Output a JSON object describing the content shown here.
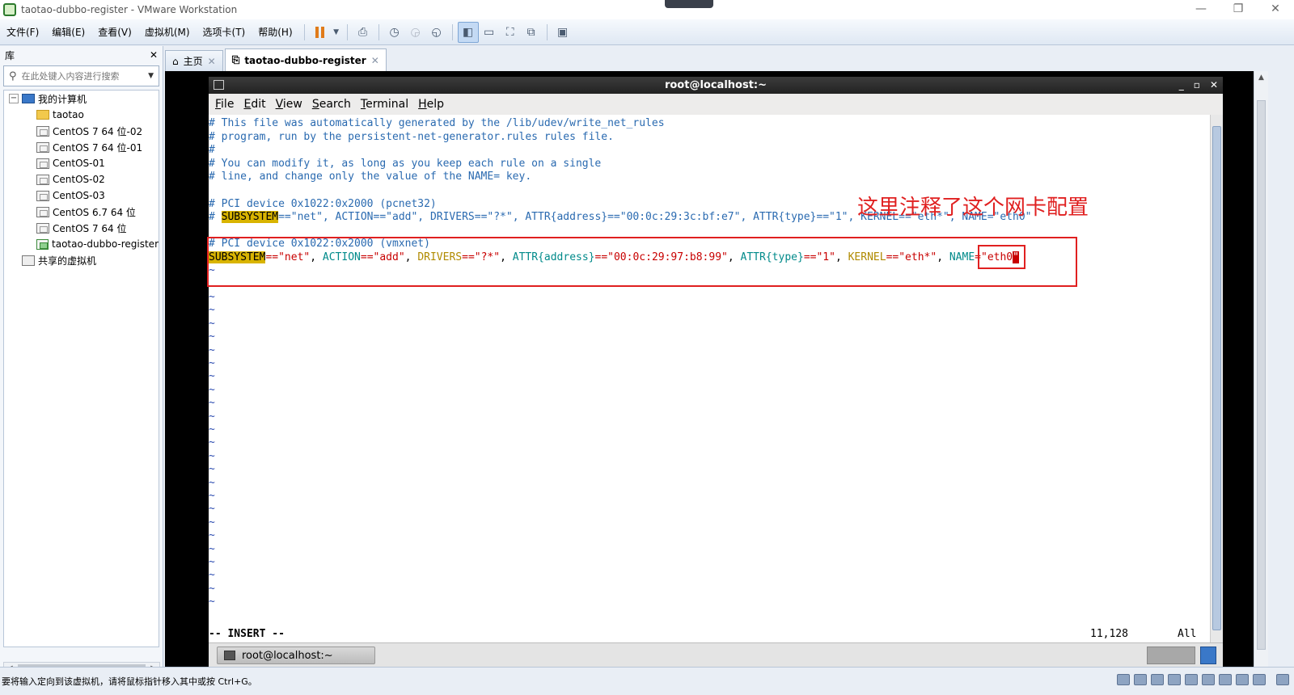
{
  "window": {
    "title": "taotao-dubbo-register - VMware Workstation",
    "minimize": "—",
    "restore": "❐",
    "close": "✕"
  },
  "menu": {
    "items": [
      "文件(F)",
      "编辑(E)",
      "查看(V)",
      "虚拟机(M)",
      "选项卡(T)",
      "帮助(H)"
    ]
  },
  "library": {
    "title": "库",
    "close": "✕",
    "search_placeholder": "在此处键入内容进行搜索",
    "items": [
      {
        "label": "我的计算机",
        "expander": "−"
      },
      {
        "label": "taotao"
      },
      {
        "label": "CentOS 7 64 位-02"
      },
      {
        "label": "CentOS 7 64 位-01"
      },
      {
        "label": "CentOS-01"
      },
      {
        "label": "CentOS-02"
      },
      {
        "label": "CentOS-03"
      },
      {
        "label": "CentOS 6.7 64 位"
      },
      {
        "label": "CentOS 7 64 位"
      },
      {
        "label": "taotao-dubbo-register"
      },
      {
        "label": "共享的虚拟机"
      }
    ]
  },
  "tabs": [
    {
      "label": "主页",
      "close": "✕"
    },
    {
      "label": "taotao-dubbo-register",
      "close": "✕"
    }
  ],
  "terminal": {
    "title": "root@localhost:~",
    "controls": [
      "_",
      "▫",
      "✕"
    ],
    "menu": [
      {
        "key": "F",
        "rest": "ile"
      },
      {
        "key": "E",
        "rest": "dit"
      },
      {
        "key": "V",
        "rest": "iew"
      },
      {
        "key": "S",
        "rest": "earch"
      },
      {
        "key": "T",
        "rest": "erminal"
      },
      {
        "key": "H",
        "rest": "elp"
      }
    ],
    "lines": {
      "l1": "# This file was automatically generated by the /lib/udev/write_net_rules",
      "l2": "# program, run by the persistent-net-generator.rules rules file.",
      "l3": "#",
      "l4": "# You can modify it, as long as you keep each rule on a single",
      "l5": "# line, and change only the value of the NAME= key.",
      "l7": "# PCI device 0x1022:0x2000 (pcnet32)",
      "l8_prefix": "# ",
      "l8_hl": "SUBSYSTEM",
      "l8_rest": "==\"net\", ACTION==\"add\", DRIVERS==\"?*\", ATTR{address}==\"00:0c:29:3c:bf:e7\", ATTR{type}==\"1\", KERNEL==\"eth*\", NAME=\"eth0\"",
      "l10": "# PCI device 0x1022:0x2000 (vmxnet)",
      "l11": {
        "k1": "SUBSYSTEM",
        "v1": "==\"net\"",
        "s1": ", ",
        "k2": "ACTION",
        "v2": "==\"add\"",
        "s2": ", ",
        "k3": "DRIVERS",
        "v3": "==\"?*\"",
        "s3": ", ",
        "k4": "ATTR{address}",
        "v4": "==\"00:0c:29:97:b8:99\"",
        "s4": ", ",
        "k5": "ATTR{type}",
        "v5": "==\"1\"",
        "s5": ", ",
        "k6": "KERNEL",
        "v6": "==\"eth*\"",
        "s6": ", ",
        "k7": "NAME",
        "v7a": "=\"eth0",
        "cursor": "\""
      },
      "tilde": "~"
    },
    "status_mode": "-- INSERT --",
    "status_pos": "11,128",
    "status_scroll": "All",
    "taskbar_item": "root@localhost:~"
  },
  "annotation": {
    "text": "这里注释了这个网卡配置",
    "color": "#e02020"
  },
  "statusbar": {
    "message": "要将输入定向到该虚拟机，请将鼠标指针移入其中或按 Ctrl+G。"
  }
}
